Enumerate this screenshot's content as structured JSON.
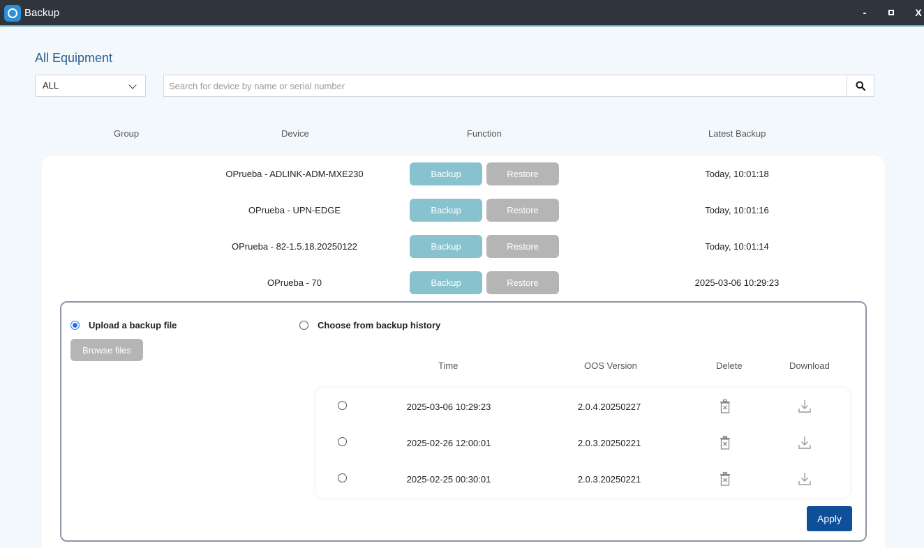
{
  "window": {
    "title": "Backup",
    "minimize_label": "-",
    "close_label": "X"
  },
  "heading": "All Equipment",
  "filter": {
    "selected": "ALL"
  },
  "search": {
    "placeholder": "Search for device by name or serial number"
  },
  "columns": {
    "group": "Group",
    "device": "Device",
    "function": "Function",
    "latest_backup": "Latest Backup"
  },
  "buttons": {
    "backup": "Backup",
    "restore": "Restore",
    "browse": "Browse files",
    "apply": "Apply"
  },
  "devices": [
    {
      "name": "OPrueba - ADLINK-ADM-MXE230",
      "latest": "Today, 10:01:18"
    },
    {
      "name": "OPrueba - UPN-EDGE",
      "latest": "Today, 10:01:16"
    },
    {
      "name": "OPrueba - 82-1.5.18.20250122",
      "latest": "Today, 10:01:14"
    },
    {
      "name": "OPrueba - 70",
      "latest": "2025-03-06 10:29:23"
    }
  ],
  "restore_panel": {
    "upload_label": "Upload a backup file",
    "history_label": "Choose from backup history",
    "upload_selected": true,
    "history_columns": {
      "time": "Time",
      "version": "OOS Version",
      "delete": "Delete",
      "download": "Download"
    },
    "history": [
      {
        "time": "2025-03-06 10:29:23",
        "version": "2.0.4.20250227"
      },
      {
        "time": "2025-02-26 12:00:01",
        "version": "2.0.3.20250221"
      },
      {
        "time": "2025-02-25 00:30:01",
        "version": "2.0.3.20250221"
      }
    ]
  },
  "icons": {
    "app": "app-logo-icon",
    "search": "search-icon",
    "dropdown": "chevron-down-icon",
    "delete": "trash-icon",
    "download": "download-icon"
  },
  "colors": {
    "accent": "#0d4f98",
    "backup_button": "#88c2cf",
    "restore_button": "#b5b5b5",
    "heading": "#2b5f8f",
    "titlebar": "#2f353d"
  }
}
